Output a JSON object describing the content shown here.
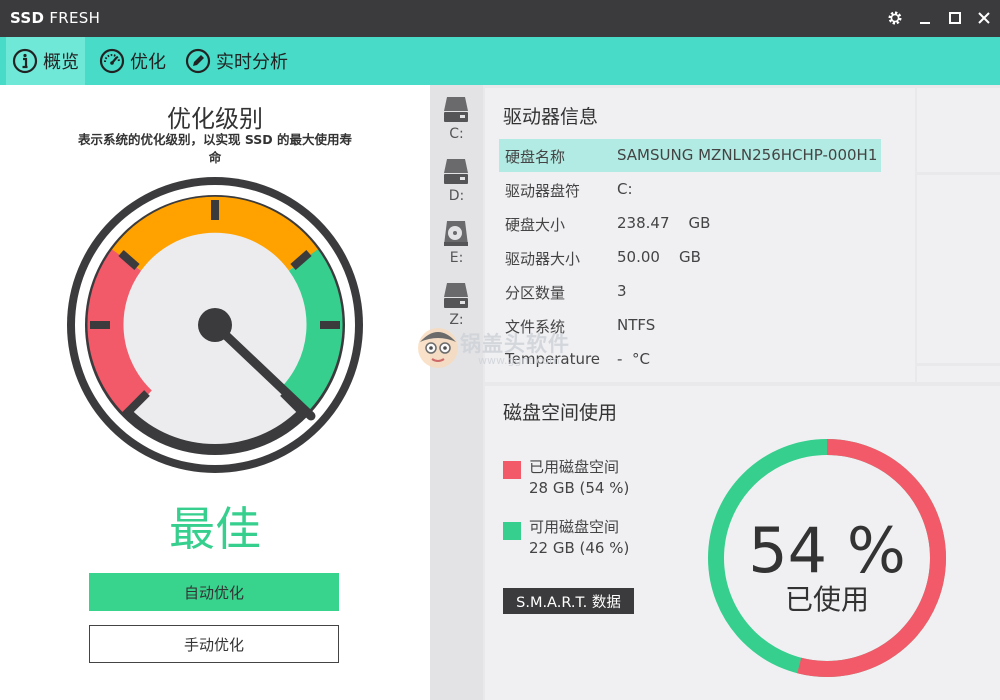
{
  "titlebar": {
    "brand_bold": "SSD",
    "brand_rest": " FRESH",
    "icons": [
      "gear-icon",
      "minimize-icon",
      "maximize-icon",
      "close-icon"
    ]
  },
  "tabs": [
    {
      "label": "概览",
      "icon": "info-icon",
      "active": true
    },
    {
      "label": "优化",
      "icon": "speedometer-icon",
      "active": false
    },
    {
      "label": "实时分析",
      "icon": "pencil-icon",
      "active": false
    }
  ],
  "optimization": {
    "title": "优化级别",
    "description": "表示系统的优化级别，以实现 SSD 的最大使用寿命",
    "status": "最佳",
    "auto_button": "自动优化",
    "manual_button": "手动优化"
  },
  "drives": [
    {
      "letter": "C:",
      "icon": "hard-drive-icon"
    },
    {
      "letter": "D:",
      "icon": "hard-drive-icon"
    },
    {
      "letter": "E:",
      "icon": "disc-drive-icon"
    },
    {
      "letter": "Z:",
      "icon": "hard-drive-icon"
    }
  ],
  "drive_info": {
    "title": "驱动器信息",
    "rows": [
      {
        "label": "硬盘名称",
        "value": "SAMSUNG MZNLN256HCHP-000H1"
      },
      {
        "label": "驱动器盘符",
        "value": "C:"
      },
      {
        "label": "硬盘大小",
        "value": "238.47    GB"
      },
      {
        "label": "驱动器大小",
        "value": "50.00    GB"
      },
      {
        "label": "分区数量",
        "value": "3"
      },
      {
        "label": "文件系统",
        "value": "NTFS"
      },
      {
        "label": "Temperature",
        "value": "-  °C"
      }
    ]
  },
  "disk_usage": {
    "title": "磁盘空间使用",
    "used_label": "已用磁盘空间",
    "used_value": "28 GB (54 %)",
    "free_label": "可用磁盘空间",
    "free_value": "22 GB (46 %)",
    "smart_button": "S.M.A.R.T. 数据",
    "percent_text": "54 %",
    "percent_label": "已使用",
    "used_fraction": 0.54,
    "used_color": "#f25a6a",
    "free_color": "#36cf8d"
  },
  "watermark": {
    "text": "锅盖头软件",
    "url": "www.ggnt.com"
  },
  "colors": {
    "accent": "#48dcc8",
    "good": "#36cf8d",
    "warn": "#ffa200",
    "bad": "#f25a6a",
    "dark": "#3b3b3d"
  }
}
